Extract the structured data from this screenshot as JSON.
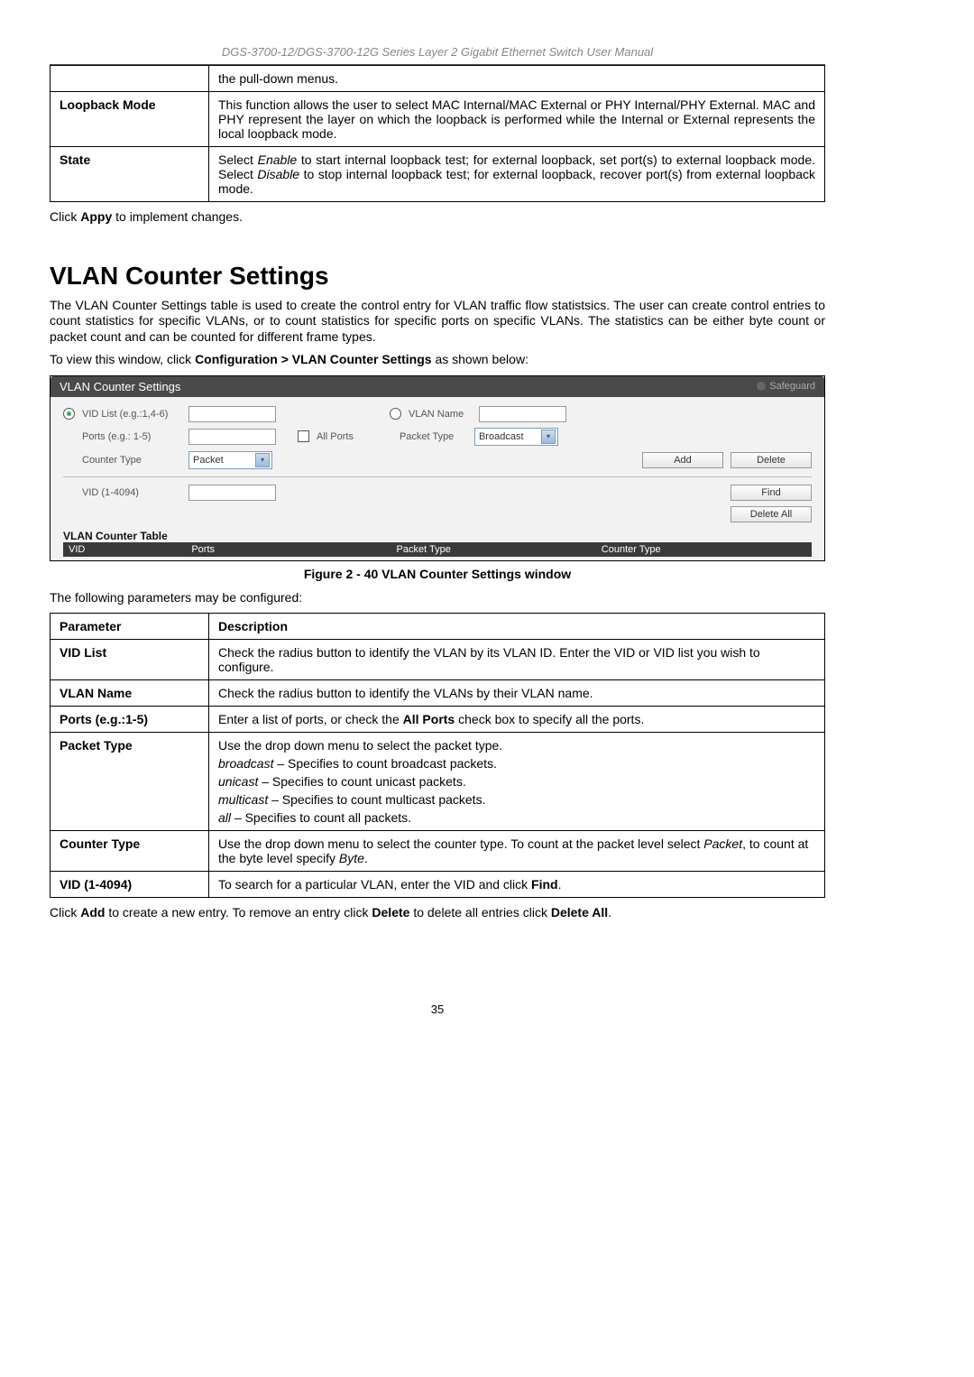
{
  "header": "DGS-3700-12/DGS-3700-12G Series Layer 2 Gigabit Ethernet Switch User Manual",
  "table1": {
    "rows": [
      {
        "param": "",
        "desc": "the pull-down menus."
      },
      {
        "param": "Loopback Mode",
        "desc": "This function allows the user to select MAC Internal/MAC External or PHY Internal/PHY External. MAC and PHY represent the layer on which the loopback is performed while the Internal or External represents the local loopback mode."
      }
    ],
    "state_param": "State",
    "state_pre": "Select ",
    "state_i1": "Enable",
    "state_mid1": " to start internal loopback test; for external loopback, set port(s) to external loopback mode. Select ",
    "state_i2": "Disable",
    "state_mid2": " to stop internal loopback test; for external loopback, recover port(s) from external loopback mode."
  },
  "after_t1_pre": "Click ",
  "after_t1_b": "Appy",
  "after_t1_post": " to implement changes.",
  "section_title": "VLAN Counter Settings",
  "intro": "The VLAN Counter Settings table is used to create the control entry for VLAN traffic flow statistsics. The user can create control entries to count statistics for specific VLANs, or to count statistics for specific ports on specific VLANs. The statistics can be either byte count or packet count and can be counted for different frame types.",
  "nav_pre": "To view this window, click ",
  "nav_b": "Configuration > VLAN Counter Settings",
  "nav_post": " as shown below:",
  "screenshot": {
    "title": "VLAN Counter Settings",
    "safeguard": "Safeguard",
    "vid_list_label": "VID List (e.g.:1,4-6)",
    "vlan_name_label": "VLAN Name",
    "ports_label": "Ports (e.g.: 1-5)",
    "all_ports": "All Ports",
    "packet_type_label": "Packet Type",
    "packet_type_value": "Broadcast",
    "counter_type_label": "Counter Type",
    "counter_type_value": "Packet",
    "add": "Add",
    "delete": "Delete",
    "vid_range": "VID (1-4094)",
    "find": "Find",
    "delete_all": "Delete All",
    "table_title": "VLAN Counter Table",
    "th_vid": "VID",
    "th_ports": "Ports",
    "th_packet": "Packet Type",
    "th_counter": "Counter Type"
  },
  "figure_caption": "Figure 2 - 40 VLAN Counter Settings window",
  "params_intro": "The following parameters may be configured:",
  "table2_head_param": "Parameter",
  "table2_head_desc": "Description",
  "table2": {
    "rows": [
      {
        "param": "VID List",
        "desc": "Check the radius button to identify the VLAN by its VLAN ID. Enter the VID or VID list you wish to configure."
      },
      {
        "param": "VLAN Name",
        "desc": "Check the radius button to identify the VLANs by their VLAN name."
      }
    ],
    "ports_param": "Ports (e.g.:1-5)",
    "ports_pre": "Enter a list of ports, or check the ",
    "ports_b": "All Ports",
    "ports_post": " check box to specify all the ports.",
    "packet_param": "Packet Type",
    "packet_l1": "Use the drop down menu to select the packet type.",
    "packet_i1": "broadcast",
    "packet_t1": " – Specifies to count broadcast packets.",
    "packet_i2": "unicast",
    "packet_t2": " – Specifies to count unicast packets.",
    "packet_i3": "multicast",
    "packet_t3": " – Specifies to count multicast packets.",
    "packet_i4": "all",
    "packet_t4": " – Specifies to count all packets.",
    "counter_param": "Counter Type",
    "counter_pre": "Use the drop down menu to select the counter type. To count at the packet level select ",
    "counter_i1": "Packet",
    "counter_mid": ", to count at the byte level specify ",
    "counter_i2": "Byte",
    "counter_post": ".",
    "vid_param": "VID (1-4094)",
    "vid_pre": "To search for a particular VLAN, enter the VID and click ",
    "vid_b": "Find",
    "vid_post": "."
  },
  "footer_pre": "Click ",
  "footer_b1": "Add",
  "footer_mid1": " to create a new entry. To remove an entry click ",
  "footer_b2": "Delete",
  "footer_mid2": " to delete all entries click ",
  "footer_b3": "Delete All",
  "footer_post": ".",
  "page_number": "35"
}
